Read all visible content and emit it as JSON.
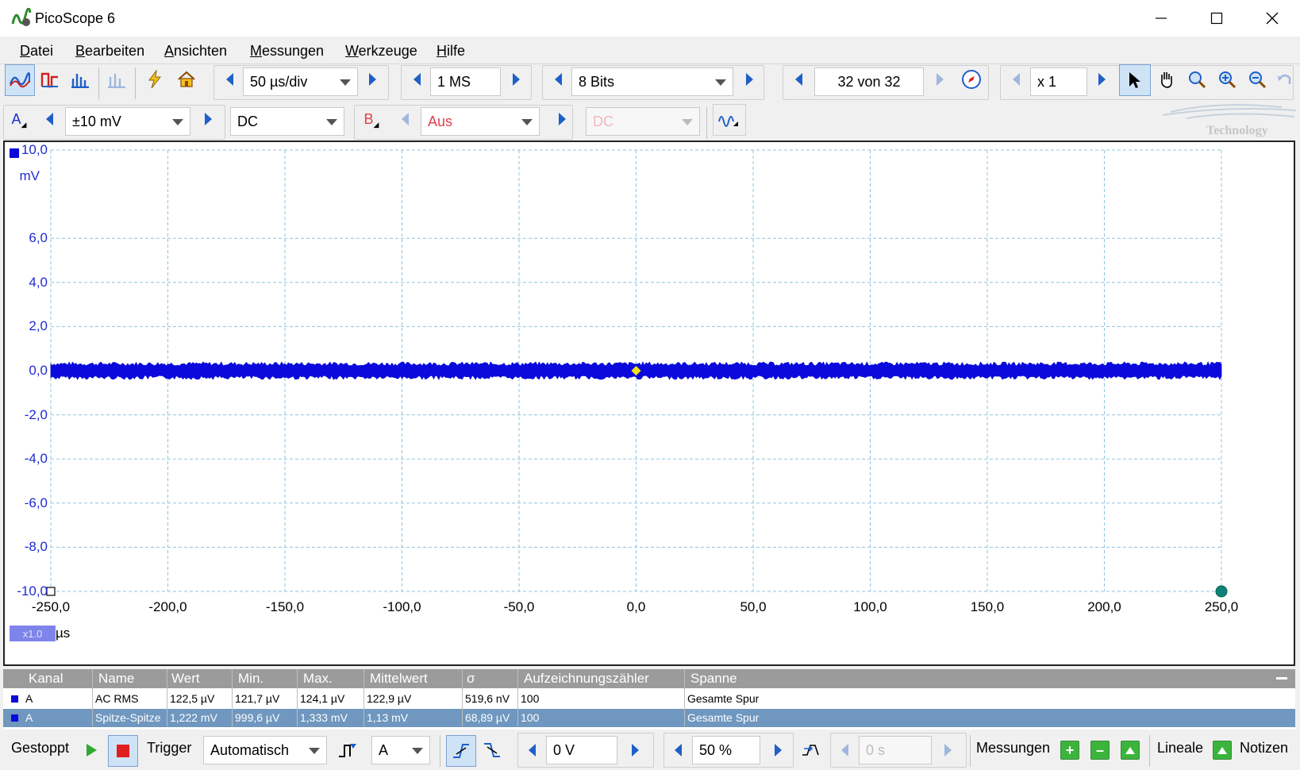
{
  "title": "PicoScope 6",
  "menu": [
    "Datei",
    "Bearbeiten",
    "Ansichten",
    "Messungen",
    "Werkzeuge",
    "Hilfe"
  ],
  "toolbar": {
    "timebase": "50 µs/div",
    "samples": "1 MS",
    "resolution": "8 Bits",
    "buffer": "32 von 32",
    "zoom": "x 1"
  },
  "channels": {
    "a_label": "A",
    "a_range": "±10 mV",
    "a_coupling": "DC",
    "b_label": "B",
    "b_range": "Aus",
    "b_coupling": "DC"
  },
  "logo_text": "Technology",
  "scope": {
    "y_unit": "mV",
    "y_ticks": [
      "10,0",
      "6,0",
      "4,0",
      "2,0",
      "0,0",
      "-2,0",
      "-4,0",
      "-6,0",
      "-8,0",
      "-10,0"
    ],
    "x_ticks": [
      "-250,0",
      "-200,0",
      "-150,0",
      "-100,0",
      "-50,0",
      "0,0",
      "50,0",
      "100,0",
      "150,0",
      "200,0",
      "250,0"
    ],
    "x_unit": "µs",
    "x_zoom": "x1.0",
    "trace_color": "#0a0adc",
    "trigger_color": "#f0e020"
  },
  "chart_data": {
    "type": "line",
    "xlabel": "µs",
    "ylabel": "mV",
    "xlim": [
      -250,
      250
    ],
    "ylim": [
      -10,
      10
    ],
    "series": [
      {
        "x": [
          -250,
          250
        ],
        "y": [
          0.0,
          0.0
        ]
      }
    ]
  },
  "measurements": {
    "headers": [
      "Kanal",
      "Name",
      "Wert",
      "Min.",
      "Max.",
      "Mittelwert",
      "σ",
      "Aufzeichnungszähler",
      "Spanne"
    ],
    "rows": [
      [
        "A",
        "AC RMS",
        "122,5 µV",
        "121,7 µV",
        "124,1 µV",
        "122,9 µV",
        "519,6 nV",
        "100",
        "Gesamte Spur"
      ],
      [
        "A",
        "Spitze-Spitze",
        "1,222 mV",
        "999,6 µV",
        "1,333 mV",
        "1,13 mV",
        "68,89 µV",
        "100",
        "Gesamte Spur"
      ]
    ]
  },
  "bottom": {
    "status": "Gestoppt",
    "trigger_label": "Trigger",
    "trigger_mode": "Automatisch",
    "trigger_source": "A",
    "threshold": "0 V",
    "pretrigger": "50 %",
    "delay": "0 s",
    "measurements_label": "Messungen",
    "rulers_label": "Lineale",
    "notes_label": "Notizen"
  }
}
